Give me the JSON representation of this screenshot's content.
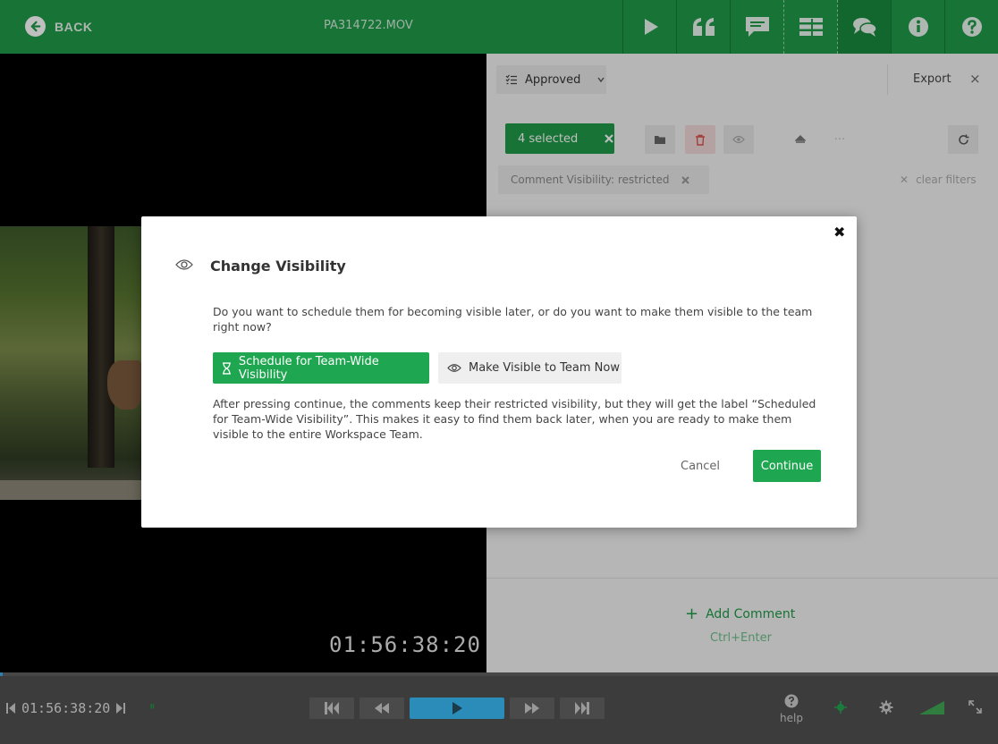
{
  "header": {
    "back_label": "BACK",
    "filename": "PA314722.MOV",
    "icons": [
      "play-icon",
      "quote-icon",
      "comment-icon",
      "list-icon",
      "chat-icon",
      "info-icon",
      "help-icon"
    ]
  },
  "video": {
    "timecode": "01:56:38:20"
  },
  "panel": {
    "status_label": "Approved",
    "export_label": "Export",
    "close_glyph": "×",
    "selected_label": "4 selected",
    "filter_label": "Comment Visibility: restricted",
    "clear_filters_label": "clear filters",
    "add_comment_label": "Add Comment",
    "add_comment_shortcut": "Ctrl+Enter"
  },
  "modal": {
    "close_glyph": "✖",
    "title": "Change Visibility",
    "question": "Do you want to schedule them for becoming visible later, or do you want to make them visible to the team right now?",
    "schedule_button": "Schedule for Team-Wide Visibility",
    "visible_now_button": "Make Visible to Team Now",
    "info": "After pressing continue, the comments keep their restricted visibility, but they will get the label “Scheduled for Team-Wide Visibility”. This makes it easy to find them back later, when you are ready to make them visible to the entire Workspace Team.",
    "cancel_label": "Cancel",
    "continue_label": "Continue"
  },
  "controls": {
    "timecode": "01:56:38:20",
    "help_label": "help"
  },
  "colors": {
    "brand_green": "#1f9a48",
    "button_green": "#1fa650",
    "play_blue": "#2b8bb9"
  }
}
